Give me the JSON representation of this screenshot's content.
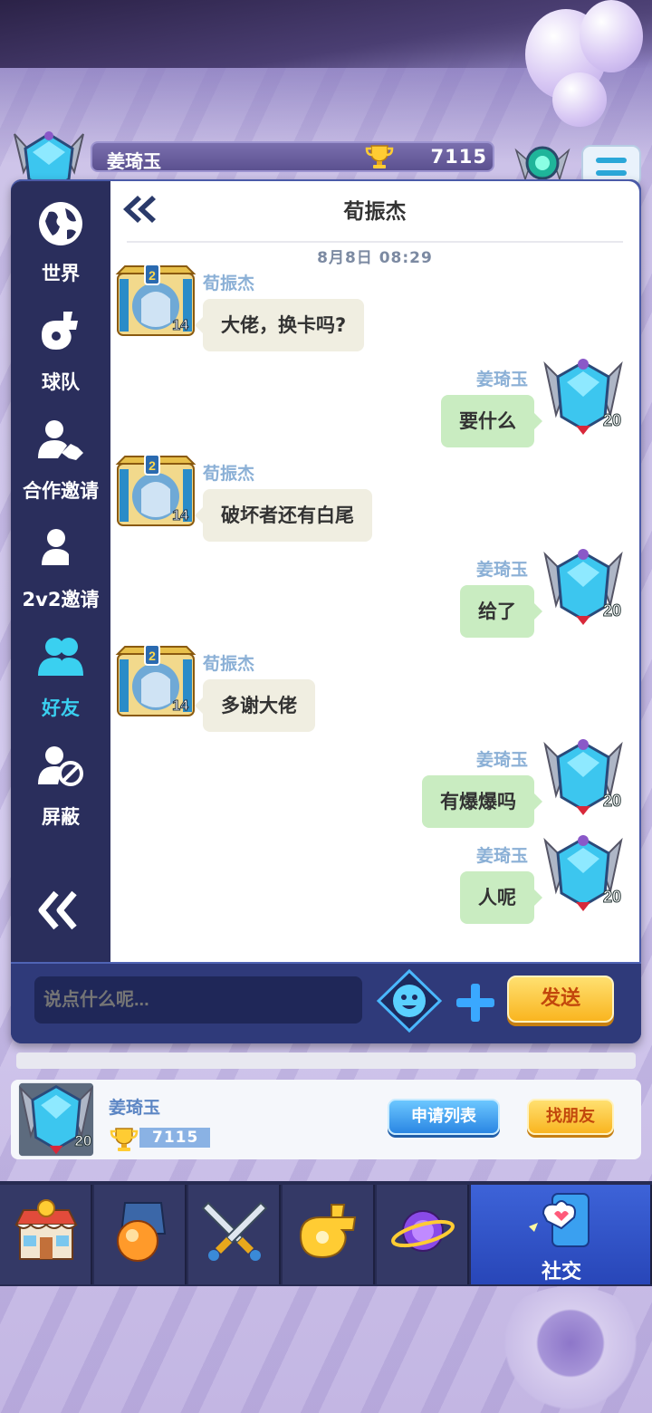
{
  "header": {
    "player_name": "姜琦玉",
    "trophies": "7115"
  },
  "sidebar": {
    "items": [
      {
        "label": "世界"
      },
      {
        "label": "球队"
      },
      {
        "label": "合作邀请"
      },
      {
        "label": "2v2邀请"
      },
      {
        "label": "好友",
        "active": true
      },
      {
        "label": "屏蔽"
      }
    ]
  },
  "chat": {
    "title": "荀振杰",
    "timestamp": "8月8日 08:29",
    "messages": [
      {
        "side": "left",
        "sender": "荀振杰",
        "text": "大佬，换卡吗?",
        "level": "14",
        "rank": "2"
      },
      {
        "side": "right",
        "sender": "姜琦玉",
        "text": "要什么",
        "level": "20"
      },
      {
        "side": "left",
        "sender": "荀振杰",
        "text": "破坏者还有白尾",
        "level": "14",
        "rank": "2"
      },
      {
        "side": "right",
        "sender": "姜琦玉",
        "text": "给了",
        "level": "20"
      },
      {
        "side": "left",
        "sender": "荀振杰",
        "text": "多谢大佬",
        "level": "14",
        "rank": "2"
      },
      {
        "side": "right",
        "sender": "姜琦玉",
        "text": "有爆爆吗",
        "level": "20"
      },
      {
        "side": "right",
        "sender": "姜琦玉",
        "text": "人呢",
        "level": "20"
      }
    ]
  },
  "input": {
    "placeholder": "说点什么呢...",
    "send_label": "发送"
  },
  "friend_card": {
    "name": "姜琦玉",
    "trophies": "7115",
    "level": "20",
    "apply_list_label": "申请列表",
    "find_friend_label": "找朋友"
  },
  "bottom_nav": {
    "items": [
      {
        "icon": "shop-icon"
      },
      {
        "icon": "gacha-capsule-icon"
      },
      {
        "icon": "crossed-swords-icon"
      },
      {
        "icon": "whistle-icon"
      },
      {
        "icon": "planet-icon"
      },
      {
        "icon": "social-icon",
        "label": "社交",
        "active": true
      }
    ]
  },
  "colors": {
    "accent_cyan": "#3ad0f0",
    "send_yellow": "#f9b520",
    "panel_navy": "#2c3264",
    "bubble_left": "#f0eee1",
    "bubble_right": "#c9ecc1"
  }
}
